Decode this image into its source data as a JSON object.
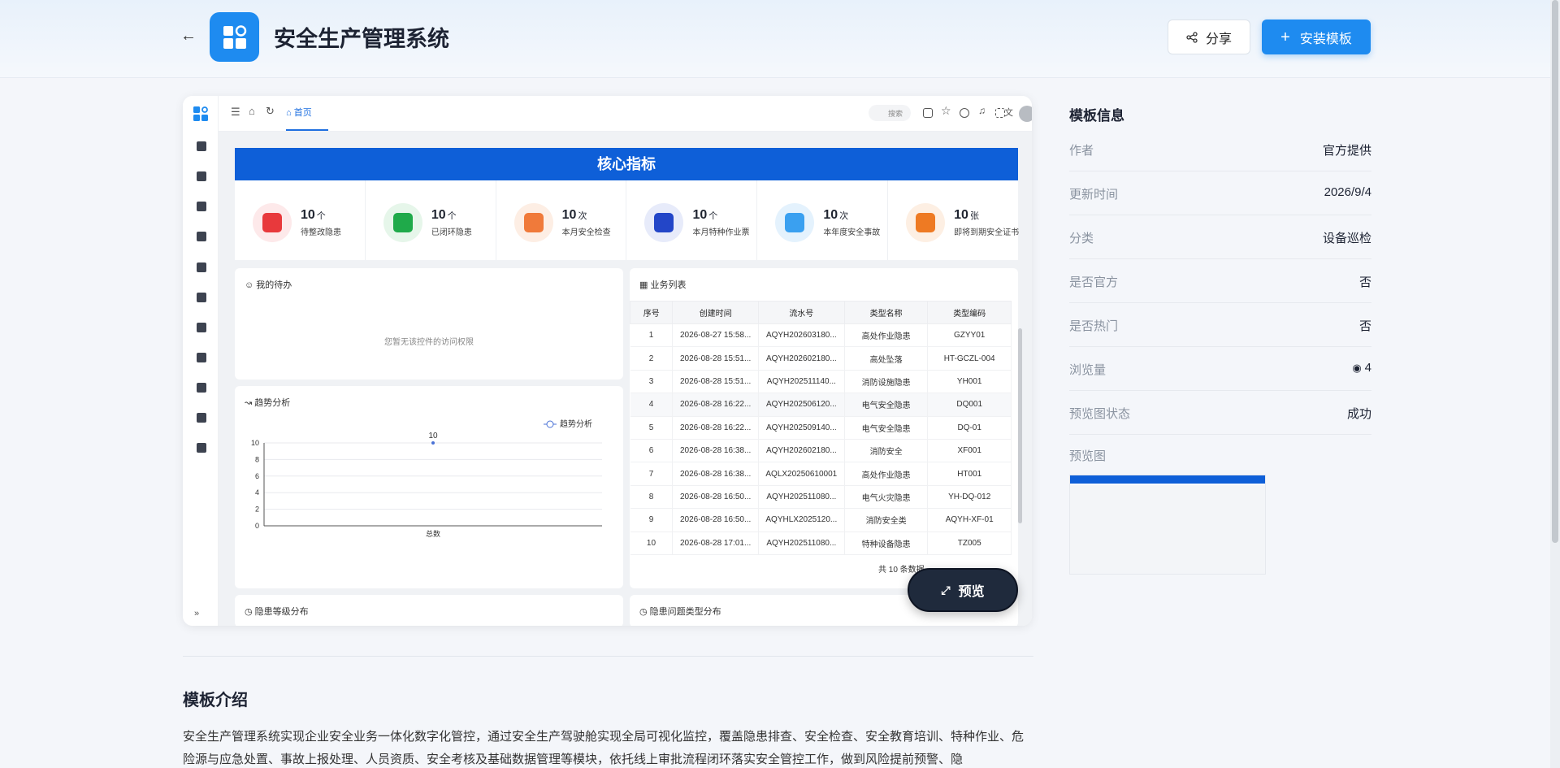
{
  "header": {
    "title": "安全生产管理系统",
    "share_label": "分享",
    "install_label": "安装模板"
  },
  "preview": {
    "top": {
      "tab_home": "首页",
      "search_placeholder": "搜索"
    },
    "kpi_title": "核心指标",
    "kpis": [
      {
        "value": "10",
        "unit": "个",
        "label": "待整改隐患",
        "color": "#e8393c",
        "bg": "#fde9ea"
      },
      {
        "value": "10",
        "unit": "个",
        "label": "已闭环隐患",
        "color": "#1faa4a",
        "bg": "#e6f6ea"
      },
      {
        "value": "10",
        "unit": "次",
        "label": "本月安全检查",
        "color": "#f07a3a",
        "bg": "#fdeee4"
      },
      {
        "value": "10",
        "unit": "个",
        "label": "本月特种作业票",
        "color": "#2346c8",
        "bg": "#e7ebfa"
      },
      {
        "value": "10",
        "unit": "次",
        "label": "本年度安全事故",
        "color": "#3aa0f0",
        "bg": "#e4f2fd"
      },
      {
        "value": "10",
        "unit": "张",
        "label": "即将到期安全证书",
        "color": "#ee7a23",
        "bg": "#fdefe3"
      }
    ],
    "todo": {
      "title": "我的待办",
      "empty": "您暂无该控件的访问权限"
    },
    "trend": {
      "title": "趋势分析",
      "legend": "趋势分析"
    },
    "biz": {
      "title": "业务列表",
      "columns": [
        "序号",
        "创建时间",
        "流水号",
        "类型名称",
        "类型编码"
      ],
      "rows": [
        [
          "1",
          "2026-08-27 15:58...",
          "AQYH202603180...",
          "高处作业隐患",
          "GZYY01"
        ],
        [
          "2",
          "2026-08-28 15:51...",
          "AQYH202602180...",
          "高处坠落",
          "HT-GCZL-004"
        ],
        [
          "3",
          "2026-08-28 15:51...",
          "AQYH202511140...",
          "消防设施隐患",
          "YH001"
        ],
        [
          "4",
          "2026-08-28 16:22...",
          "AQYH202506120...",
          "电气安全隐患",
          "DQ001"
        ],
        [
          "5",
          "2026-08-28 16:22...",
          "AQYH202509140...",
          "电气安全隐患",
          "DQ-01"
        ],
        [
          "6",
          "2026-08-28 16:38...",
          "AQYH202602180...",
          "消防安全",
          "XF001"
        ],
        [
          "7",
          "2026-08-28 16:38...",
          "AQLX20250610001",
          "高处作业隐患",
          "HT001"
        ],
        [
          "8",
          "2026-08-28 16:50...",
          "AQYH202511080...",
          "电气火灾隐患",
          "YH-DQ-012"
        ],
        [
          "9",
          "2026-08-28 16:50...",
          "AQYHLX2025120...",
          "消防安全类",
          "AQYH-XF-01"
        ],
        [
          "10",
          "2026-08-28 17:01...",
          "AQYH202511080...",
          "特种设备隐患",
          "TZ005"
        ]
      ],
      "pager_text": "共 10 条数据"
    },
    "level_title": "隐患等级分布",
    "type_title": "隐患问题类型分布",
    "preview_button": "预览"
  },
  "chart_data": {
    "type": "line",
    "categories": [
      "总数"
    ],
    "series": [
      {
        "name": "趋势分析",
        "values": [
          10
        ]
      }
    ],
    "data_labels": [
      "10"
    ],
    "yticks": [
      "0",
      "2",
      "4",
      "6",
      "8",
      "10"
    ],
    "ylim": [
      0,
      10
    ],
    "grid": true,
    "legend": "top-right"
  },
  "intro": {
    "title": "模板介绍",
    "text": "安全生产管理系统实现企业安全业务一体化数字化管控，通过安全生产驾驶舱实现全局可视化监控，覆盖隐患排查、安全检查、安全教育培训、特种作业、危险源与应急处置、事故上报处理、人员资质、安全考核及基础数据管理等模块，依托线上审批流程闭环落实安全管控工作，做到风险提前预警、隐"
  },
  "info": {
    "title": "模板信息",
    "rows": [
      {
        "k": "作者",
        "v": "官方提供"
      },
      {
        "k": "更新时间",
        "v": "2026/9/4"
      },
      {
        "k": "分类",
        "v": "设备巡检"
      },
      {
        "k": "是否官方",
        "v": "否"
      },
      {
        "k": "是否热门",
        "v": "否"
      },
      {
        "k": "浏览量",
        "v": "4"
      },
      {
        "k": "预览图状态",
        "v": "成功"
      }
    ],
    "preview_label": "预览图"
  }
}
